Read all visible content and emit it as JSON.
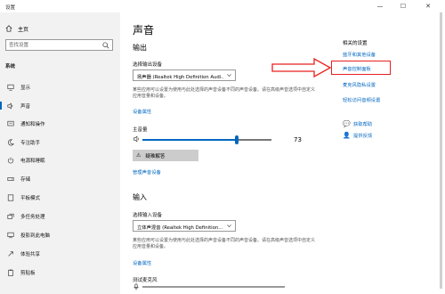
{
  "window": {
    "title": "设置",
    "controls": {
      "minimize": "—",
      "maximize": "☐",
      "close": "✕"
    }
  },
  "sidebar": {
    "home_label": "主页",
    "search_placeholder": "查找设置",
    "section_label": "系统",
    "items": [
      {
        "label": "显示",
        "icon": "monitor-icon",
        "active": false
      },
      {
        "label": "声音",
        "icon": "speaker-icon",
        "active": true
      },
      {
        "label": "通知和操作",
        "icon": "notification-icon",
        "active": false
      },
      {
        "label": "专注助手",
        "icon": "moon-icon",
        "active": false
      },
      {
        "label": "电源和睡眠",
        "icon": "power-icon",
        "active": false
      },
      {
        "label": "存储",
        "icon": "storage-icon",
        "active": false
      },
      {
        "label": "平板模式",
        "icon": "tablet-icon",
        "active": false
      },
      {
        "label": "多任务处理",
        "icon": "multitask-icon",
        "active": false
      },
      {
        "label": "投影到此电脑",
        "icon": "project-icon",
        "active": false
      },
      {
        "label": "体验共享",
        "icon": "share-icon",
        "active": false
      },
      {
        "label": "剪贴板",
        "icon": "clipboard-icon",
        "active": false
      }
    ]
  },
  "main": {
    "title": "声音",
    "output": {
      "heading": "输出",
      "device_label": "选择输出设备",
      "device_value": "扬声器 (Realtek High Definition Audi...",
      "description": "某些应用可以设置为使用与此处选择的声音设备不同的声音设备。请在高级声音选项中自定义应用音量和设备。",
      "device_properties": "设备属性",
      "master_volume_label": "主音量",
      "volume_value": "73",
      "volume_level": 0.73,
      "troubleshoot_label": "疑难解答",
      "manage_devices": "管理声音设备"
    },
    "input": {
      "heading": "输入",
      "device_label": "选择输入设备",
      "device_value": "立体声混音 (Realtek High Definition...",
      "description": "某些应用可以设置为使用与此处选择的声音设备不同的声音设备。请在高级声音选项中自定义应用音量和设备。",
      "device_properties": "设备属性",
      "test_mic_label": "测试麦克风"
    }
  },
  "related": {
    "title": "相关的设置",
    "links": [
      "蓝牙和其他设备",
      "声音控制面板",
      "麦克风隐私设置",
      "轻松访问音频设置"
    ],
    "help": "获取帮助",
    "feedback": "提供反馈"
  },
  "colors": {
    "accent": "#0067c0",
    "annotation": "#e8201d",
    "sidebar_bg": "#f2f2f2"
  }
}
